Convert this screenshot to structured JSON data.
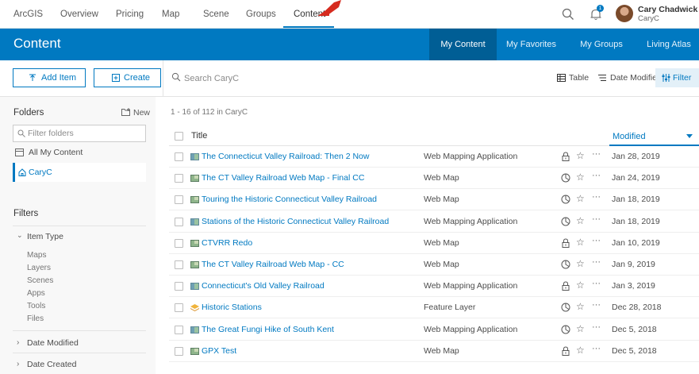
{
  "topnav": {
    "items": [
      "ArcGIS",
      "Overview",
      "Pricing",
      "Map",
      "Scene",
      "Groups",
      "Content"
    ],
    "active": "Content",
    "notification_count": "1",
    "user_name": "Cary Chadwick",
    "user_id": "CaryC"
  },
  "banner": {
    "title": "Content",
    "tabs": [
      "My Content",
      "My Favorites",
      "My Groups",
      "Living Atlas"
    ],
    "active_tab": "My Content"
  },
  "toolbar": {
    "add_item": "Add Item",
    "create": "Create",
    "search_placeholder": "Search CaryC",
    "view_label": "Table",
    "sort_label": "Date Modified",
    "filter_label": "Filter"
  },
  "sidebar": {
    "folders_label": "Folders",
    "new_label": "New",
    "filter_placeholder": "Filter folders",
    "all_content": "All My Content",
    "current_folder": "CaryC",
    "filters_label": "Filters",
    "item_type_label": "Item Type",
    "item_types": [
      "Maps",
      "Layers",
      "Scenes",
      "Apps",
      "Tools",
      "Files"
    ],
    "date_modified_label": "Date Modified",
    "date_created_label": "Date Created"
  },
  "list": {
    "count_text": "1 - 16 of 112 in CaryC",
    "col_title": "Title",
    "col_modified": "Modified",
    "rows": [
      {
        "title": "The Connecticut Valley Railroad: Then 2 Now",
        "type": "Web Mapping Application",
        "share": "lock",
        "date": "Jan 28, 2019"
      },
      {
        "title": "The CT Valley Railroad Web Map - Final CC",
        "type": "Web Map",
        "share": "shared",
        "date": "Jan 24, 2019"
      },
      {
        "title": "Touring the Historic Connecticut Valley Railroad",
        "type": "Web Map",
        "share": "shared",
        "date": "Jan 18, 2019"
      },
      {
        "title": "Stations of the Historic Connecticut Valley Railroad",
        "type": "Web Mapping Application",
        "share": "shared",
        "date": "Jan 18, 2019"
      },
      {
        "title": "CTVRR Redo",
        "type": "Web Map",
        "share": "lock",
        "date": "Jan 10, 2019"
      },
      {
        "title": "The CT Valley Railroad Web Map - CC",
        "type": "Web Map",
        "share": "shared",
        "date": "Jan 9, 2019"
      },
      {
        "title": "Connecticut's Old Valley Railroad",
        "type": "Web Mapping Application",
        "share": "lock",
        "date": "Jan 3, 2019"
      },
      {
        "title": "Historic Stations",
        "type": "Feature Layer",
        "share": "shared",
        "date": "Dec 28, 2018"
      },
      {
        "title": "The Great Fungi Hike of South Kent",
        "type": "Web Mapping Application",
        "share": "shared",
        "date": "Dec 5, 2018"
      },
      {
        "title": "GPX Test",
        "type": "Web Map",
        "share": "lock",
        "date": "Dec 5, 2018"
      }
    ]
  },
  "colors": {
    "brand_blue": "#0079c1",
    "active_tab": "#005e95",
    "annotation_arrow": "#d62b1f"
  }
}
